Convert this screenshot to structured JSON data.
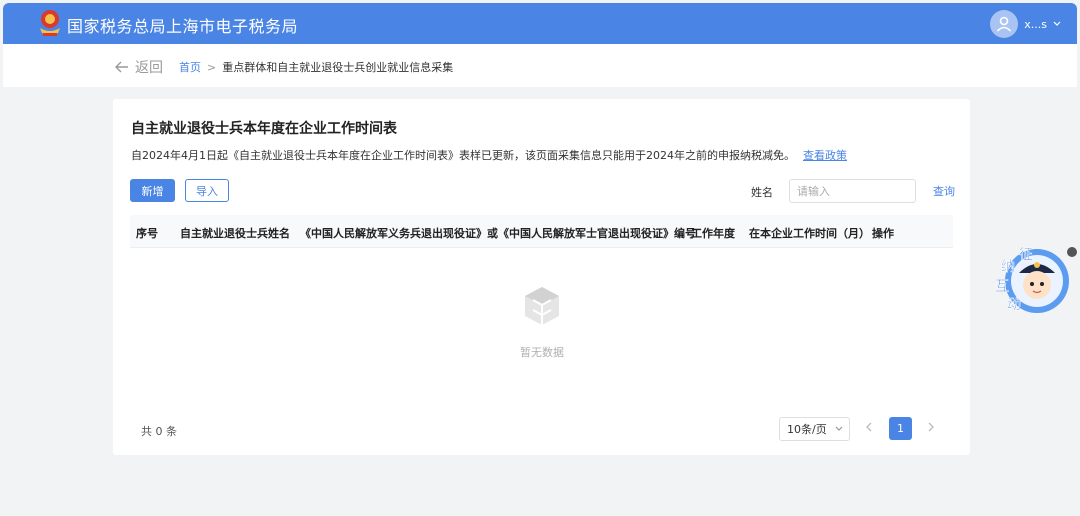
{
  "header": {
    "app_title": "国家税务总局上海市电子税务局",
    "user_name": "x...s",
    "brand_color": "#4a84e4"
  },
  "nav": {
    "back_label": "返回",
    "breadcrumb": {
      "home": "首页",
      "separator": ">",
      "current": "重点群体和自主就业退役士兵创业就业信息采集"
    }
  },
  "page": {
    "title": "自主就业退役士兵本年度在企业工作时间表",
    "notice": "自2024年4月1日起《自主就业退役士兵本年度在企业工作时间表》表样已更新，该页面采集信息只能用于2024年之前的申报纳税减免。",
    "notice_link": "查看政策"
  },
  "toolbar": {
    "add_label": "新增",
    "import_label": "导入",
    "name_filter_label": "姓名",
    "name_filter_placeholder": "请输入",
    "search_label": "查询"
  },
  "table": {
    "columns": [
      "序号",
      "自主就业退役士兵姓名",
      "《中国人民解放军义务兵退出现役证》或《中国人民解放军士官退出现役证》编号",
      "工作年度",
      "在本企业工作时间（月）",
      "操作"
    ],
    "rows": [],
    "empty_text": "暂无数据"
  },
  "pagination": {
    "total_text": "共 0 条",
    "page_size": "10条/页",
    "current_page": "1"
  },
  "float_widget": {
    "chars": [
      "征",
      "纳",
      "互",
      "动"
    ]
  }
}
